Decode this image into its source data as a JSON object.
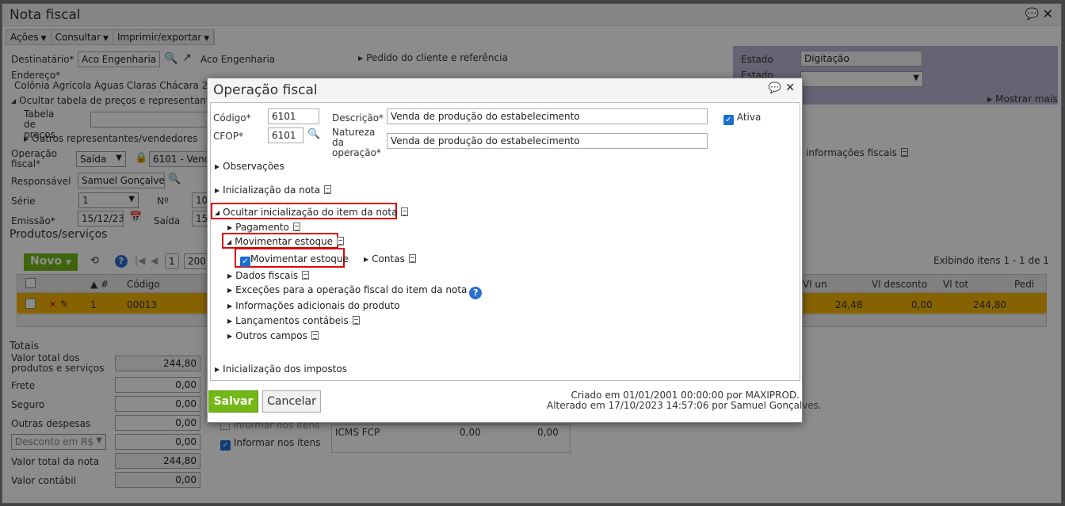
{
  "window": {
    "title": "Nota fiscal"
  },
  "menu": {
    "acoes": "Ações",
    "consultar": "Consultar",
    "imprimir": "Imprimir/exportar"
  },
  "form": {
    "destinatario_label": "Destinatário*",
    "destinatario_value": "Aco Engenharia",
    "destinatario_link": "Aco Engenharia",
    "pedido_link": "Pedido do cliente e referência",
    "endereco_label": "Endereço*",
    "endereco_value": "Colônia Agrícola Águas Claras Chácara 23, Lo",
    "ocultar_tabela": "Ocultar tabela de preços e representante/v",
    "tabela_label": "Tabela de preços",
    "outros_repr": "Outros representantes/vendedores",
    "operacao_label": "Operação fiscal*",
    "operacao_tipo": "Saída",
    "operacao_value": "6101 - Vend",
    "responsavel_label": "Responsável",
    "responsavel_value": "Samuel Gonçalves",
    "serie_label": "Série",
    "serie_value": "1",
    "numero_label": "Nº",
    "numero_value": "10",
    "emissao_label": "Emissão*",
    "emissao_value": "15/12/23",
    "saida_label": "Saída",
    "saida_value": "15",
    "estado_label": "Estado",
    "estado_value": "Digitação",
    "estado2_label": "Estado",
    "mostrar_mais": "Mostrar mais",
    "info_fiscais": "informações fiscais"
  },
  "produtos": {
    "title": "Produtos/serviços",
    "novo": "Novo",
    "page": "1",
    "page_size": "200",
    "exibindo": "Exibindo itens 1 - 1 de 1",
    "cols": {
      "num": "#",
      "codigo": "Código",
      "vl_un": "Vl un",
      "vl_desconto": "Vl desconto",
      "vl_tot": "Vl tot",
      "pedi": "Pedi"
    },
    "row": {
      "num": "1",
      "codigo": "00013",
      "vl_un": "24,48",
      "vl_desconto": "0,00",
      "vl_tot": "244,80"
    }
  },
  "totais": {
    "title": "Totais",
    "valor_total_label": "Valor total dos produtos e serviços",
    "valor_total_value": "244,80",
    "frete_label": "Frete",
    "frete_value": "0,00",
    "seguro_label": "Seguro",
    "seguro_value": "0,00",
    "outras_label": "Outras despesas",
    "outras_value": "0,00",
    "desconto_label": "Desconto em R$",
    "desconto_value": "0,00",
    "nota_label": "Valor total da nota",
    "nota_value": "244,80",
    "contabil_label": "Valor contábil",
    "contabil_value": "0,00",
    "informar_itens": "Informar nos itens",
    "informar_itens2": "Informar nos itens",
    "icms_fcp_label": "ICMS FCP",
    "icms_fcp_v1": "0,00",
    "icms_fcp_v2": "0,00"
  },
  "dialog": {
    "title": "Operação fiscal",
    "codigo_label": "Código*",
    "codigo_value": "6101",
    "cfop_label": "CFOP*",
    "cfop_value": "6101",
    "descricao_label": "Descrição*",
    "descricao_value": "Venda de produção do estabelecimento",
    "natureza_label": "Natureza da operação*",
    "natureza_value": "Venda de produção do estabelecimento",
    "ativa_label": "Ativa",
    "observacoes": "Observações",
    "inicializacao_nota": "Inicialização da nota",
    "ocultar_item": "Ocultar inicialização do item da nota",
    "pagamento": "Pagamento",
    "movimentar_estoque": "Movimentar estoque",
    "movimentar_estoque_chk": "Movimentar estoque",
    "contas": "Contas",
    "dados_fiscais": "Dados fiscais",
    "excecoes": "Exceções para a operação fiscal do item da nota",
    "info_adicionais": "Informações adicionais do produto",
    "lancamentos": "Lançamentos contábeis",
    "outros_campos": "Outros campos",
    "inicializacao_impostos": "Inicialização dos impostos",
    "salvar": "Salvar",
    "cancelar": "Cancelar",
    "criado": "Criado em 01/01/2001 00:00:00 por MAXIPROD.",
    "alterado": "Alterado em 17/10/2023 14:57:06 por Samuel Gonçalves."
  },
  "colors": {
    "accent_green": "#74b816",
    "highlight_red": "#e00000",
    "row_yellow": "#f5b400",
    "check_blue": "#1a6fd1"
  }
}
